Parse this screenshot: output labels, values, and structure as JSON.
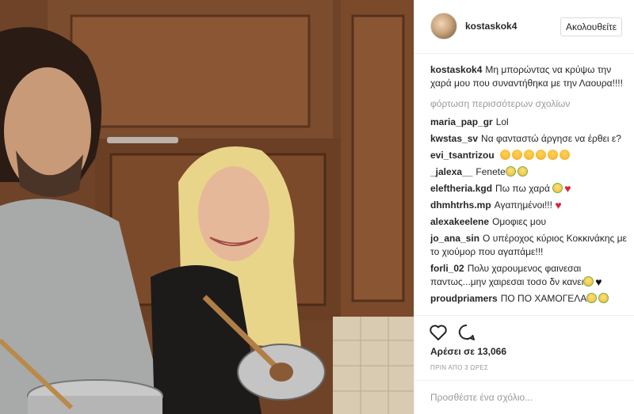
{
  "post": {
    "username": "kostaskok4",
    "follow_label": "Ακολουθείτε",
    "caption": "Μη μπορώντας να κρύψω την χαρά μου που συναντήθηκα με την Λαουρα!!!!",
    "load_more_label": "φόρτωση περισσότερων σχολίων",
    "likes_label": "Αρέσει σε 13,066",
    "time_label": "ΠΡΙΝ ΑΠΟ 3 ΩΡΕΣ",
    "comment_placeholder": "Προσθέστε ένα σχόλιο..."
  },
  "comments": [
    {
      "user": "maria_pap_gr",
      "text": "Lol",
      "emojis": []
    },
    {
      "user": "kwstas_sv",
      "text": "Να φανταστώ άργησε να έρθει ε?",
      "emojis": []
    },
    {
      "user": "evi_tsantrizou",
      "text": "",
      "emojis": [
        "kiss-emoji",
        "kiss-emoji",
        "kiss-emoji",
        "kiss-emoji",
        "kiss-emoji",
        "kiss-emoji"
      ]
    },
    {
      "user": "_jalexa__",
      "text": "Fenete",
      "emojis": [
        "tears-of-joy-emoji",
        "tears-of-joy-emoji"
      ]
    },
    {
      "user": "eleftheria.kgd",
      "text": "Πω πω χαρά",
      "emojis": [
        "tears-of-joy-emoji",
        "heart-emoji"
      ]
    },
    {
      "user": "dhmhtrhs.mp",
      "text": "Αγαπημένοι!!!",
      "emojis": [
        "heart-emoji"
      ]
    },
    {
      "user": "alexakeelene",
      "text": "Ομοφιες μου",
      "emojis": []
    },
    {
      "user": "jo_ana_sin",
      "text": "Ο υπέροχος κύριος Κοκκινάκης με το χιούμορ που αγαπάμε!!!",
      "emojis": []
    },
    {
      "user": "forli_02",
      "text": "Πολυ χαρουμενος φαινεσαι παντως...μην χαιρεσαι τοσο δν κανει",
      "emojis": [
        "tears-of-joy-emoji",
        "black-heart-emoji"
      ]
    },
    {
      "user": "proudpriamers",
      "text": "ΠΟ ΠΟ ΧΑΜΟΓΕΛΑ",
      "emojis": [
        "tears-of-joy-emoji",
        "tears-of-joy-emoji"
      ]
    }
  ],
  "icons": {
    "like": "heart-outline-icon",
    "comment": "speech-bubble-icon"
  },
  "colors": {
    "secondary_text": "#999999",
    "primary_text": "#262626",
    "border": "#efefef"
  }
}
